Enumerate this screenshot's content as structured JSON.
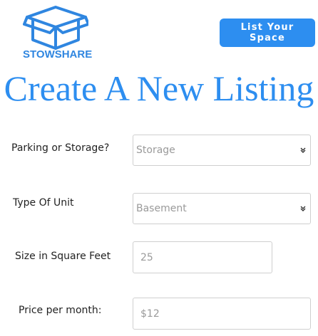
{
  "header": {
    "logo_text": "STOWSHARE",
    "cta_label": "List Your Space"
  },
  "page": {
    "title": "Create A New Listing"
  },
  "form": {
    "parking_or_storage": {
      "label": "Parking or Storage?",
      "value": "Storage"
    },
    "type_of_unit": {
      "label": "Type Of Unit",
      "value": "Basement"
    },
    "size": {
      "label": "Size in Square Feet",
      "placeholder": "25"
    },
    "price": {
      "label": "Price per month:",
      "placeholder": "$12"
    }
  },
  "colors": {
    "brand": "#2d8ef0",
    "logo": "#2f86e0"
  }
}
